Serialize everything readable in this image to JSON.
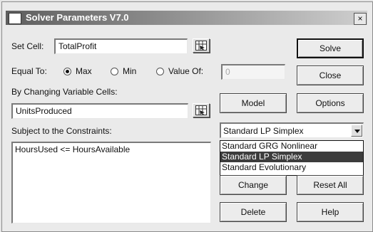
{
  "window": {
    "title": "Solver Parameters V7.0",
    "close_glyph": "×"
  },
  "set_cell": {
    "label": "Set Cell:",
    "value": "TotalProfit"
  },
  "equal_to": {
    "label": "Equal To:",
    "options": [
      {
        "label": "Max",
        "selected": true
      },
      {
        "label": "Min",
        "selected": false
      },
      {
        "label": "Value Of:",
        "selected": false
      }
    ],
    "value_of": "0"
  },
  "changing_cells": {
    "label": "By Changing Variable Cells:",
    "value": "UnitsProduced"
  },
  "constraints": {
    "label": "Subject to the Constraints:",
    "items": [
      "HoursUsed <= HoursAvailable"
    ]
  },
  "buttons": {
    "solve": "Solve",
    "close": "Close",
    "model": "Model",
    "options": "Options",
    "change": "Change",
    "reset_all": "Reset All",
    "delete": "Delete",
    "help": "Help"
  },
  "engine": {
    "selected": "Standard LP Simplex",
    "options": [
      "Standard GRG Nonlinear",
      "Standard LP Simplex",
      "Standard Evolutionary"
    ],
    "highlighted_index": 1
  },
  "icons": {
    "ref_button": "cell-reference-icon",
    "dropdown": "chevron-down-icon"
  }
}
